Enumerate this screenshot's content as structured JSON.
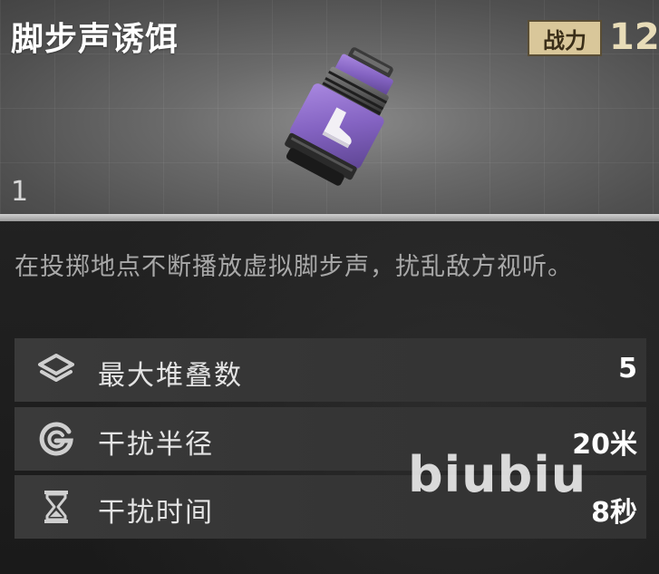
{
  "item": {
    "title": "脚步声诱饵",
    "power_label": "战力",
    "power_value": "12",
    "count": "1",
    "icon": "footstep-decoy-grenade-icon"
  },
  "description": "在投掷地点不断播放虚拟脚步声，扰乱敌方视听。",
  "stats": [
    {
      "icon": "stack-layers-icon",
      "label": "最大堆叠数",
      "value": "5"
    },
    {
      "icon": "g-circle-icon",
      "label": "干扰半径",
      "value": "20米"
    },
    {
      "icon": "hourglass-icon",
      "label": "干扰时间",
      "value": "8秒"
    }
  ],
  "watermark": "biubiu",
  "colors": {
    "accent_badge": "#d9c79a",
    "grenade_purple": "#8c69c8",
    "text_muted": "#a8a8a8"
  }
}
